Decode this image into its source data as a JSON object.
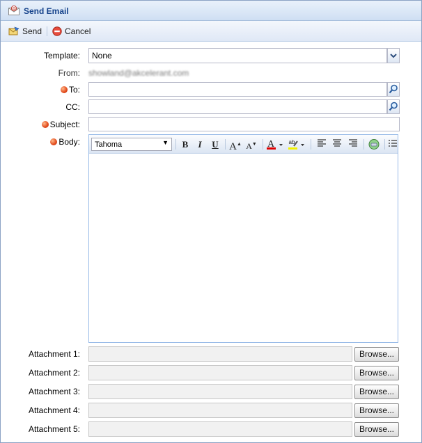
{
  "window": {
    "title": "Send Email"
  },
  "toolbar": {
    "send_label": "Send",
    "cancel_label": "Cancel"
  },
  "form": {
    "template_label": "Template:",
    "template_value": "None",
    "from_label": "From:",
    "from_value": "showland@akcelerant.com",
    "to_label": "To:",
    "cc_label": "CC:",
    "subject_label": "Subject:",
    "body_label": "Body:"
  },
  "editor": {
    "font_name": "Tahoma"
  },
  "attachments": [
    {
      "label": "Attachment 1:",
      "button": "Browse..."
    },
    {
      "label": "Attachment 2:",
      "button": "Browse..."
    },
    {
      "label": "Attachment 3:",
      "button": "Browse..."
    },
    {
      "label": "Attachment 4:",
      "button": "Browse..."
    },
    {
      "label": "Attachment 5:",
      "button": "Browse..."
    }
  ],
  "colors": {
    "title_text": "#15428b",
    "required_dot": "#e2491b",
    "font_color_bar": "#e00000",
    "highlight_bar": "#f2f200"
  }
}
